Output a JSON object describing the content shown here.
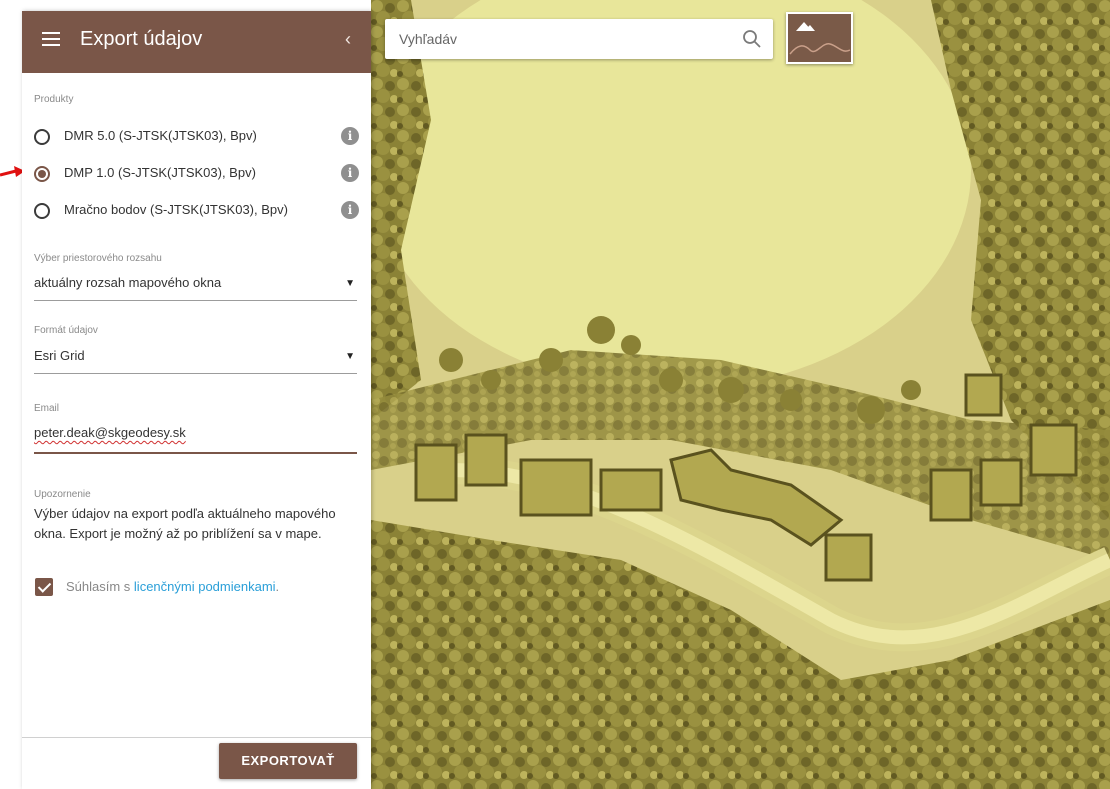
{
  "panel": {
    "title": "Export údajov",
    "products_label": "Produkty",
    "products": [
      {
        "label": "DMR 5.0 (S-JTSK(JTSK03), Bpv)",
        "selected": false
      },
      {
        "label": "DMP 1.0 (S-JTSK(JTSK03), Bpv)",
        "selected": true
      },
      {
        "label": "Mračno bodov (S-JTSK(JTSK03), Bpv)",
        "selected": false
      }
    ],
    "extent_label": "Výber priestorového rozsahu",
    "extent_value": "aktuálny rozsah mapového okna",
    "format_label": "Formát údajov",
    "format_value": "Esri Grid",
    "email_label": "Email",
    "email_value": "peter.deak@skgeodesy.sk",
    "notice_label": "Upozornenie",
    "notice_text": "Výber údajov na export podľa aktuálneho mapového okna. Export je možný až po priblížení sa v mape.",
    "consent_prefix": "Súhlasím s ",
    "consent_link": "licenčnými podmienkami",
    "consent_suffix": ".",
    "consent_checked": true,
    "export_label": "EXPORTOVAŤ"
  },
  "search": {
    "value": "Vyhľadáv"
  },
  "colors": {
    "brand": "#7a5648",
    "link": "#2a9fd8",
    "map_base": "#d9d08a",
    "map_dark": "#7d7432",
    "annotation_arrow": "#e01010"
  },
  "icons": {
    "menu": "hamburger-menu-icon",
    "collapse": "chevron-left-icon",
    "info": "info-icon",
    "search": "search-icon",
    "layer": "terrain-layer-icon"
  }
}
